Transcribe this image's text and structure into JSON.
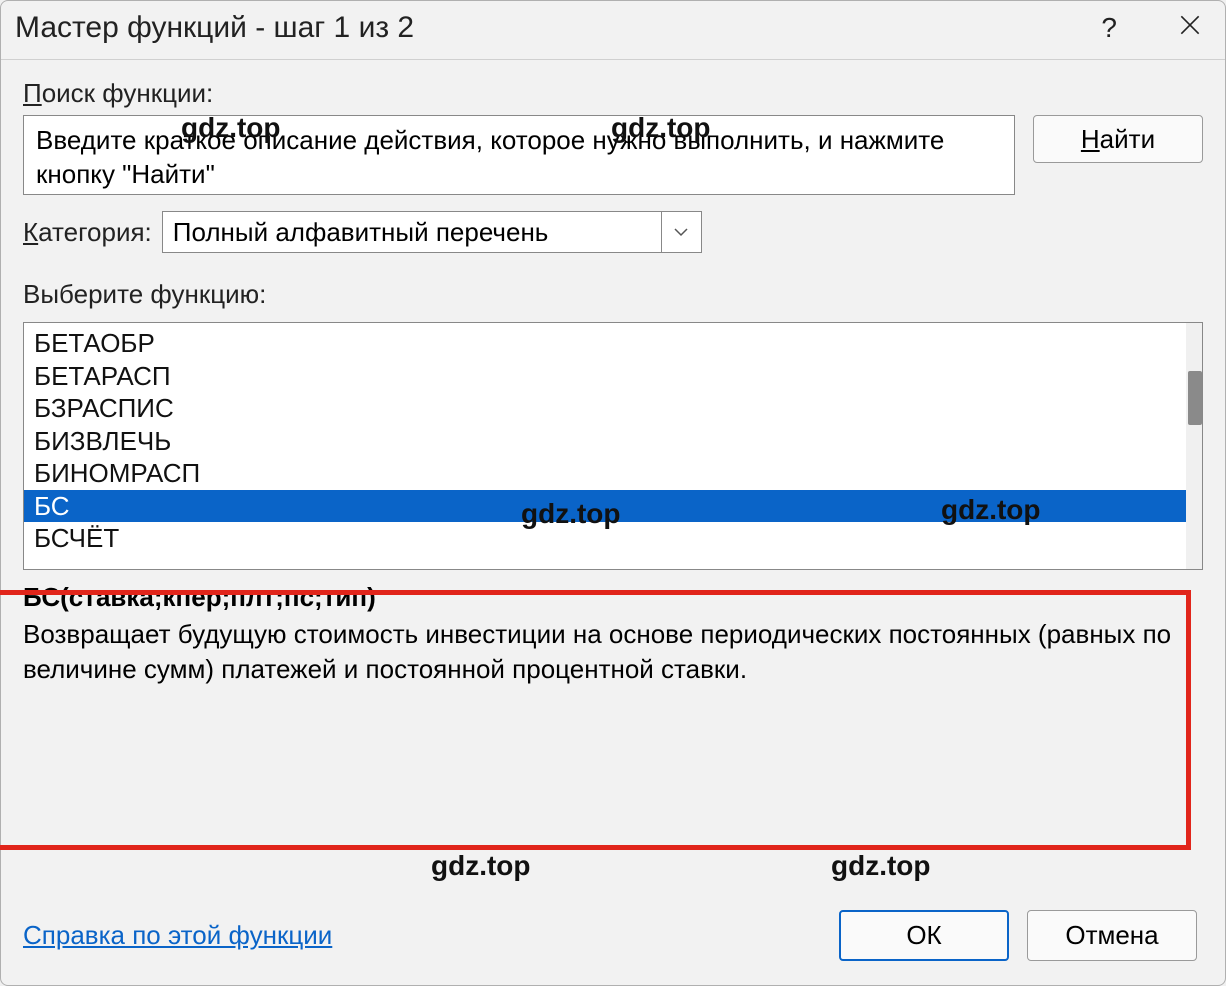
{
  "titlebar": {
    "title": "Мастер функций - шаг 1 из 2",
    "help_symbol": "?"
  },
  "search": {
    "label_prefix": "П",
    "label_rest": "оиск функции:",
    "button": "Найти",
    "button_underline": "Н",
    "value": "Введите краткое описание действия, которое нужно выполнить, и нажмите кнопку \"Найти\""
  },
  "category": {
    "label_prefix": "К",
    "label_rest": "атегория:",
    "value": "Полный алфавитный перечень"
  },
  "function_list": {
    "label": "Выберите функцию:",
    "items": [
      "БЕТАОБР",
      "БЕТАРАСП",
      "БЗРАСПИС",
      "БИЗВЛЕЧЬ",
      "БИНОМРАСП",
      "БС",
      "БСЧЁТ"
    ],
    "selected_index": 5
  },
  "info": {
    "signature": "БС(ставка;кпер;плт;пс;тип)",
    "description": "Возвращает будущую стоимость инвестиции на основе периодических постоянных (равных по величине сумм) платежей и постоянной процентной ставки."
  },
  "footer": {
    "help_link": "Справка по этой функции",
    "ok": "ОК",
    "cancel": "Отмена"
  },
  "watermarks": [
    "gdz.top",
    "gdz.top",
    "gdz.top",
    "gdz.top",
    "gdz.top",
    "gdz.top"
  ]
}
